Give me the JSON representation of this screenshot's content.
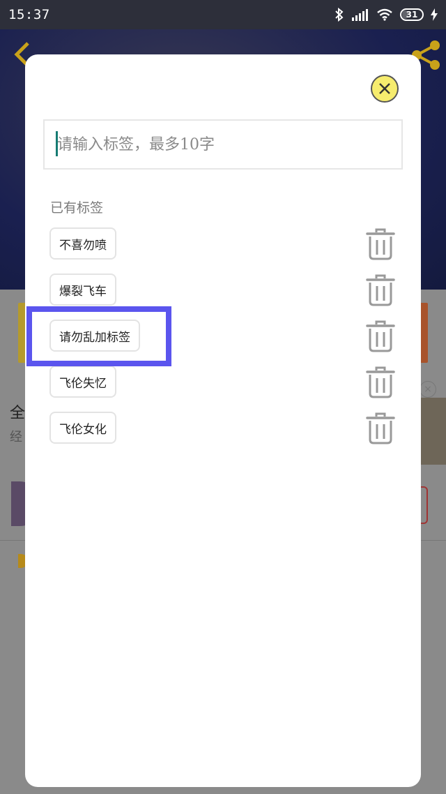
{
  "status_bar": {
    "time": "15:37",
    "battery_level": "31",
    "icons": [
      "bluetooth-icon",
      "signal-icon",
      "wifi-icon",
      "battery-icon",
      "charging-icon"
    ]
  },
  "background": {
    "text_a": "全",
    "text_b": "经",
    "thumb_close": "×"
  },
  "dialog": {
    "input_placeholder": "请输入标签，最多10字",
    "input_value": "",
    "section_label": "已有标签",
    "tags": [
      {
        "label": "不喜勿喷"
      },
      {
        "label": "爆裂飞车"
      },
      {
        "label": "请勿乱加标签"
      },
      {
        "label": "飞伦失忆"
      },
      {
        "label": "飞伦女化"
      }
    ]
  },
  "colors": {
    "accent_highlight": "#5b55ee",
    "close_button": "#f6ec6e",
    "caret": "#167b73",
    "back_arrow": "#c9a21a"
  }
}
